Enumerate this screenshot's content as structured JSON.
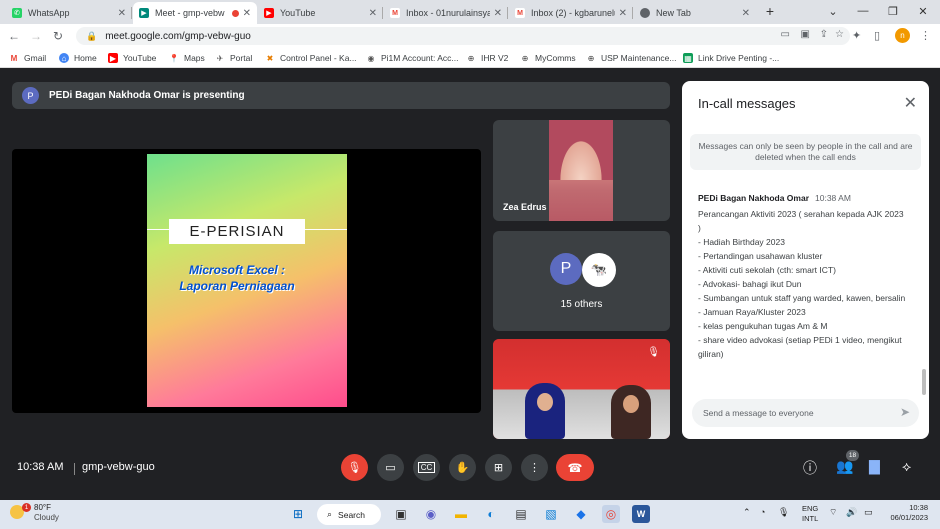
{
  "browser": {
    "tabs": [
      {
        "title": "WhatsApp",
        "icon": "whatsapp-icon",
        "color": "#25d366",
        "active": false
      },
      {
        "title": "Meet - gmp-vebw",
        "icon": "meet-icon",
        "color": "#00897b",
        "active": true
      },
      {
        "title": "YouTube",
        "icon": "youtube-icon",
        "color": "#ff0000",
        "active": false
      },
      {
        "title": "Inbox - 01nurulainsya",
        "icon": "gmail-icon",
        "color": "#ea4335",
        "active": false
      },
      {
        "title": "Inbox (2) - kgbarunelu",
        "icon": "gmail-icon",
        "color": "#ea4335",
        "active": false
      },
      {
        "title": "New Tab",
        "icon": "chrome-icon",
        "color": "#5f6368",
        "active": false
      }
    ],
    "url": "meet.google.com/gmp-vebw-guo",
    "profile_initial": "n",
    "bookmarks": [
      {
        "label": "Gmail",
        "icon": "gmail-icon"
      },
      {
        "label": "Home",
        "icon": "home-icon"
      },
      {
        "label": "YouTube",
        "icon": "youtube-icon"
      },
      {
        "label": "Maps",
        "icon": "maps-icon"
      },
      {
        "label": "Portal",
        "icon": "portal-icon"
      },
      {
        "label": "Control Panel - Ka...",
        "icon": "control-panel-icon"
      },
      {
        "label": "Pi1M Account: Acc...",
        "icon": "pi1m-icon"
      },
      {
        "label": "IHR V2",
        "icon": "globe-icon"
      },
      {
        "label": "MyComms",
        "icon": "globe-icon"
      },
      {
        "label": "USP Maintenance...",
        "icon": "globe-icon"
      },
      {
        "label": "Link Drive Penting -...",
        "icon": "sheets-icon"
      }
    ]
  },
  "meet": {
    "presenting_initial": "P",
    "presenting_text": "PEDi Bagan Nakhoda Omar is presenting",
    "slide_title": "E-PERISIAN",
    "slide_subtitle_1": "Microsoft Excel :",
    "slide_subtitle_2": "Laporan Perniagaan",
    "participant_name": "Zea Edrus",
    "others_initial": "P",
    "others_count": "15 others",
    "clock": "10:38 AM",
    "meeting_code": "gmp-vebw-guo",
    "people_count": "18"
  },
  "chat": {
    "header": "In-call messages",
    "notice": "Messages can only be seen by people in the call and are deleted when the call ends",
    "sender": "PEDi Bagan Nakhoda Omar",
    "time": "10:38 AM",
    "lines": [
      "Perancangan Aktiviti 2023 ( serahan kepada AJK 2023 )",
      "-  Hadiah Birthday 2023",
      "-  Pertandingan usahawan kluster",
      "-  Aktiviti cuti sekolah (cth: smart ICT)",
      "-  Advokasi- bahagi ikut Dun",
      "- Sumbangan untuk staff yang warded, kawen, bersalin",
      "- Jamuan Raya/Kluster 2023",
      "- kelas pengukuhan tugas Am & M",
      "- share video advokasi (setiap PEDi 1 video, mengikut giliran)"
    ],
    "input_placeholder": "Send a message to everyone"
  },
  "taskbar": {
    "temp": "80°F",
    "condition": "Cloudy",
    "weather_badge": "1",
    "search_label": "Search",
    "lang_1": "ENG",
    "lang_2": "INTL",
    "time": "10:38",
    "date": "06/01/2023"
  }
}
